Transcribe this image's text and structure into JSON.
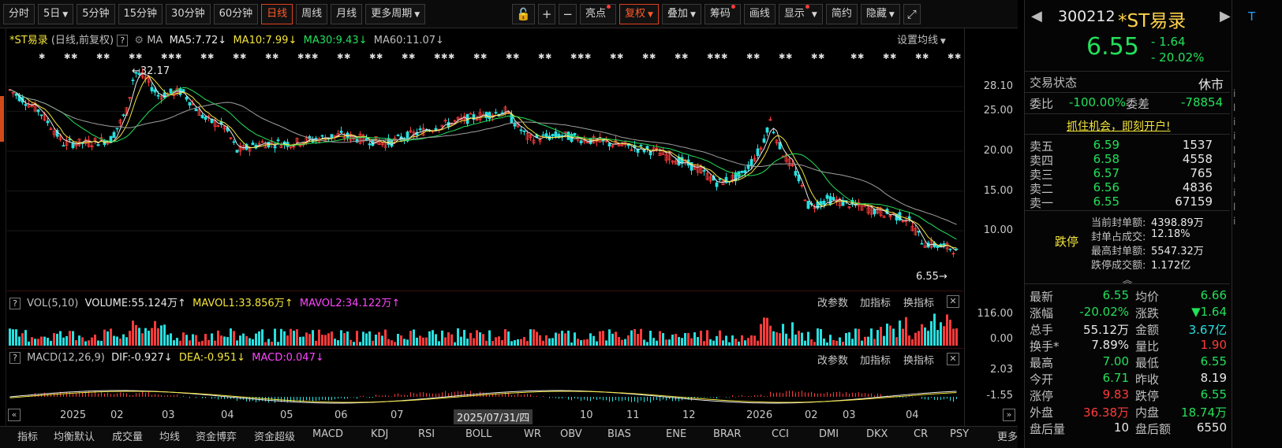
{
  "toolbar": {
    "left_tabs": [
      {
        "label": "分时",
        "active": false,
        "caret": false,
        "dot": false
      },
      {
        "label": "5日",
        "active": false,
        "caret": true,
        "dot": false
      },
      {
        "label": "5分钟",
        "active": false,
        "caret": false,
        "dot": false
      },
      {
        "label": "15分钟",
        "active": false,
        "caret": false,
        "dot": false
      },
      {
        "label": "30分钟",
        "active": false,
        "caret": false,
        "dot": false
      },
      {
        "label": "60分钟",
        "active": false,
        "caret": false,
        "dot": false
      },
      {
        "label": "日线",
        "active": true,
        "caret": false,
        "dot": false
      },
      {
        "label": "周线",
        "active": false,
        "caret": false,
        "dot": false
      },
      {
        "label": "月线",
        "active": false,
        "caret": false,
        "dot": false
      },
      {
        "label": "更多周期",
        "active": false,
        "caret": true,
        "dot": false
      }
    ],
    "lock_glyph": "🔓",
    "plus_glyph": "+",
    "minus_glyph": "−",
    "right_tabs": [
      {
        "label": "亮点",
        "active": false,
        "caret": false,
        "dot": true
      },
      {
        "label": "复权",
        "active": true,
        "caret": true,
        "dot": false
      },
      {
        "label": "叠加",
        "active": false,
        "caret": true,
        "dot": false
      },
      {
        "label": "筹码",
        "active": false,
        "caret": false,
        "dot": true
      },
      {
        "label": "画线",
        "active": false,
        "caret": false,
        "dot": false
      },
      {
        "label": "显示",
        "active": false,
        "caret": true,
        "dot": true
      },
      {
        "label": "简约",
        "active": false,
        "caret": false,
        "dot": false
      },
      {
        "label": "隐藏",
        "active": false,
        "caret": true,
        "dot": false
      }
    ],
    "expand_glyph": "⤢"
  },
  "price_panel": {
    "title": "*ST易录",
    "subtitle": "(日线,前复权)",
    "help": "?",
    "ma_label": "MA",
    "ma5": "MA5:7.72",
    "ma10": "MA10:7.99",
    "ma30": "MA30:9.43",
    "ma60": "MA60:11.07",
    "down_arrow": "↓",
    "settings": "设置均线",
    "high_marker": "32.17",
    "low_marker": "6.55",
    "y_labels": [
      "28.10",
      "25.00",
      "20.00",
      "15.00",
      "10.00"
    ],
    "y_values": [
      28.1,
      25,
      20,
      15,
      10
    ],
    "colors": {
      "ma5": "#e8e8e8",
      "ma10": "#f4e53c",
      "ma30": "#23e05a",
      "ma60": "#a0a0a0",
      "up": "#ff3b3b",
      "down": "#27e0e0"
    }
  },
  "vol_panel": {
    "label": "VOL(5,10)",
    "volume": "VOLUME:55.124万",
    "mavol1": "MAVOL1:33.856万",
    "mavol2": "MAVOL2:34.122万",
    "up_arrow": "↑",
    "y_labels": [
      "116.00",
      "0.00"
    ],
    "actions": [
      "改参数",
      "加指标",
      "换指标"
    ],
    "close": "✕"
  },
  "macd_panel": {
    "label": "MACD(12,26,9)",
    "dif": "DIF:-0.927",
    "dea": "DEA:-0.951",
    "macd": "MACD:0.047",
    "down_arrow": "↓",
    "y_labels": [
      "2.03",
      "-1.55"
    ],
    "actions": [
      "改参数",
      "加指标",
      "换指标"
    ],
    "close": "✕"
  },
  "x_axis": {
    "labels": [
      "2025",
      "02",
      "03",
      "04",
      "05",
      "06",
      "07",
      "2025/07/31/四",
      "10",
      "11",
      "12",
      "2026",
      "02",
      "03",
      "04"
    ],
    "left_nav": "«",
    "right_nav": "»"
  },
  "bottom_tabs": [
    "指标",
    "均衡默认",
    "成交量",
    "均线",
    "资金博弈",
    "资金超级",
    "MACD",
    "KDJ",
    "RSI",
    "BOLL",
    "WR",
    "OBV",
    "BIAS",
    "ENE",
    "BRAR",
    "CCI",
    "DMI",
    "DKX",
    "CR",
    "PSY",
    "更多"
  ],
  "quote": {
    "code": "300212",
    "name": "*ST易录",
    "price": "6.55",
    "change": "- 1.64",
    "change_pct": "- 20.02%",
    "nav_left": "◀",
    "nav_right": "▶",
    "t_badge": "T",
    "trade_status_label": "交易状态",
    "trade_status": "休市",
    "weibi_label": "委比",
    "weibi": "-100.00%",
    "weicha_label": "委差",
    "weicha": "-78854",
    "promo": "抓住机会，即刻开户!",
    "asks": [
      {
        "label": "卖五",
        "price": "6.59",
        "vol": "1537"
      },
      {
        "label": "卖四",
        "price": "6.58",
        "vol": "4558"
      },
      {
        "label": "卖三",
        "price": "6.57",
        "vol": "765"
      },
      {
        "label": "卖二",
        "price": "6.56",
        "vol": "4836"
      },
      {
        "label": "卖一",
        "price": "6.55",
        "vol": "67159"
      }
    ],
    "limit_label": "跌停",
    "limit_info": [
      {
        "label": "当前封单额:",
        "value": "4398.89万"
      },
      {
        "label": "封单占成交:",
        "value": "12.18%"
      },
      {
        "label": "最高封单额:",
        "value": "5547.32万"
      },
      {
        "label": "跌停成交额:",
        "value": "1.172亿"
      }
    ],
    "collapse": "︽",
    "stats": [
      {
        "l1": "最新",
        "v1": "6.55",
        "c1": "green",
        "l2": "均价",
        "v2": "6.66",
        "c2": "green"
      },
      {
        "l1": "涨幅",
        "v1": "-20.02%",
        "c1": "green",
        "l2": "涨跌",
        "v2": "▼1.64",
        "c2": "green"
      },
      {
        "l1": "总手",
        "v1": "55.12万",
        "c1": "white",
        "l2": "金额",
        "v2": "3.67亿",
        "c2": "cyan"
      },
      {
        "l1": "换手*",
        "v1": "7.89%",
        "c1": "white",
        "l2": "量比",
        "v2": "1.90",
        "c2": "red"
      },
      {
        "l1": "最高",
        "v1": "7.00",
        "c1": "green",
        "l2": "最低",
        "v2": "6.55",
        "c2": "green"
      },
      {
        "l1": "今开",
        "v1": "6.71",
        "c1": "green",
        "l2": "昨收",
        "v2": "8.19",
        "c2": "white"
      },
      {
        "l1": "涨停",
        "v1": "9.83",
        "c1": "red",
        "l2": "跌停",
        "v2": "6.55",
        "c2": "green"
      },
      {
        "l1": "外盘",
        "v1": "36.38万",
        "c1": "red",
        "l2": "内盘",
        "v2": "18.74万",
        "c2": "green"
      },
      {
        "l1": "盘后量",
        "v1": "10",
        "c1": "white",
        "l2": "盘后额",
        "v2": "6550",
        "c2": "white"
      }
    ]
  }
}
